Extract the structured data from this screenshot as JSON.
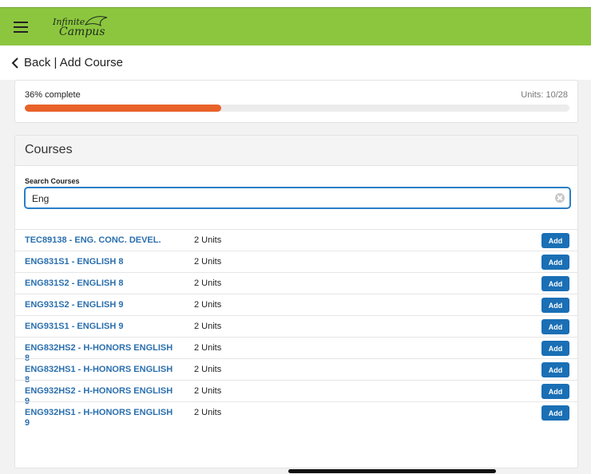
{
  "app": {
    "logo_top": "Infinite",
    "logo_bottom": "Campus",
    "brand_color": "#8cc63f"
  },
  "nav": {
    "back_label": "Back | Add Course"
  },
  "progress": {
    "label": "36% complete",
    "units": "Units: 10/28",
    "fraction": 0.36,
    "fill_color": "#e8622a"
  },
  "courses": {
    "title": "Courses",
    "search_label": "Search Courses",
    "search_value": "Eng",
    "add_label": "Add",
    "rows": [
      {
        "name": "TEC89138 - ENG. CONC. DEVEL.",
        "units": "2 Units"
      },
      {
        "name": "ENG831S1 - ENGLISH 8",
        "units": "2 Units"
      },
      {
        "name": "ENG831S2 - ENGLISH 8",
        "units": "2 Units"
      },
      {
        "name": "ENG931S2 - ENGLISH 9",
        "units": "2 Units"
      },
      {
        "name": "ENG931S1 - ENGLISH 9",
        "units": "2 Units"
      },
      {
        "name": "ENG832HS2 - H-HONORS ENGLISH 8",
        "units": "2 Units"
      },
      {
        "name": "ENG832HS1 - H-HONORS ENGLISH 8",
        "units": "2 Units"
      },
      {
        "name": "ENG932HS2 - H-HONORS ENGLISH 9",
        "units": "2 Units"
      },
      {
        "name": "ENG932HS1 - H-HONORS ENGLISH 9",
        "units": "2 Units"
      }
    ]
  }
}
